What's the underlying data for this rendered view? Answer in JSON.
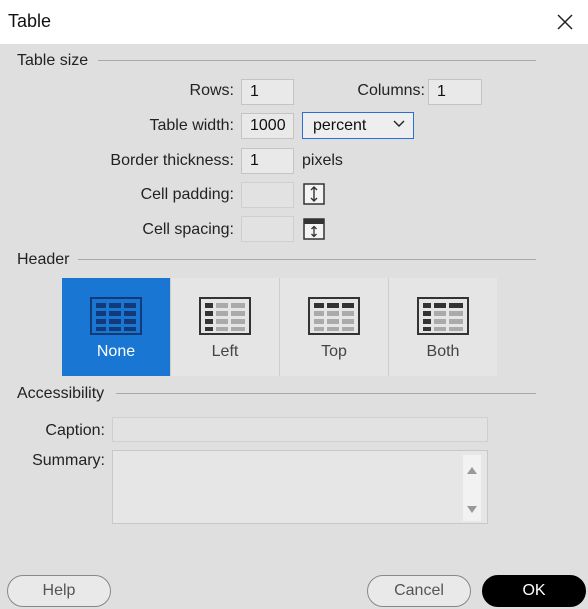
{
  "window": {
    "title": "Table"
  },
  "table_size": {
    "section_title": "Table size",
    "rows_label": "Rows:",
    "rows_value": "1",
    "columns_label": "Columns:",
    "columns_value": "1",
    "width_label": "Table width:",
    "width_value": "1000",
    "width_unit_selected": "percent",
    "border_label": "Border thickness:",
    "border_value": "1",
    "border_unit": "pixels",
    "padding_label": "Cell padding:",
    "padding_value": "",
    "spacing_label": "Cell spacing:",
    "spacing_value": ""
  },
  "header": {
    "section_title": "Header",
    "options": [
      {
        "label": "None",
        "selected": true
      },
      {
        "label": "Left",
        "selected": false
      },
      {
        "label": "Top",
        "selected": false
      },
      {
        "label": "Both",
        "selected": false
      }
    ]
  },
  "accessibility": {
    "section_title": "Accessibility",
    "caption_label": "Caption:",
    "caption_value": "",
    "summary_label": "Summary:",
    "summary_value": ""
  },
  "footer": {
    "help_label": "Help",
    "cancel_label": "Cancel",
    "ok_label": "OK"
  },
  "colors": {
    "accent": "#1976d2",
    "dialog_bg": "#dfdfdf",
    "ok_bg": "#000000"
  }
}
